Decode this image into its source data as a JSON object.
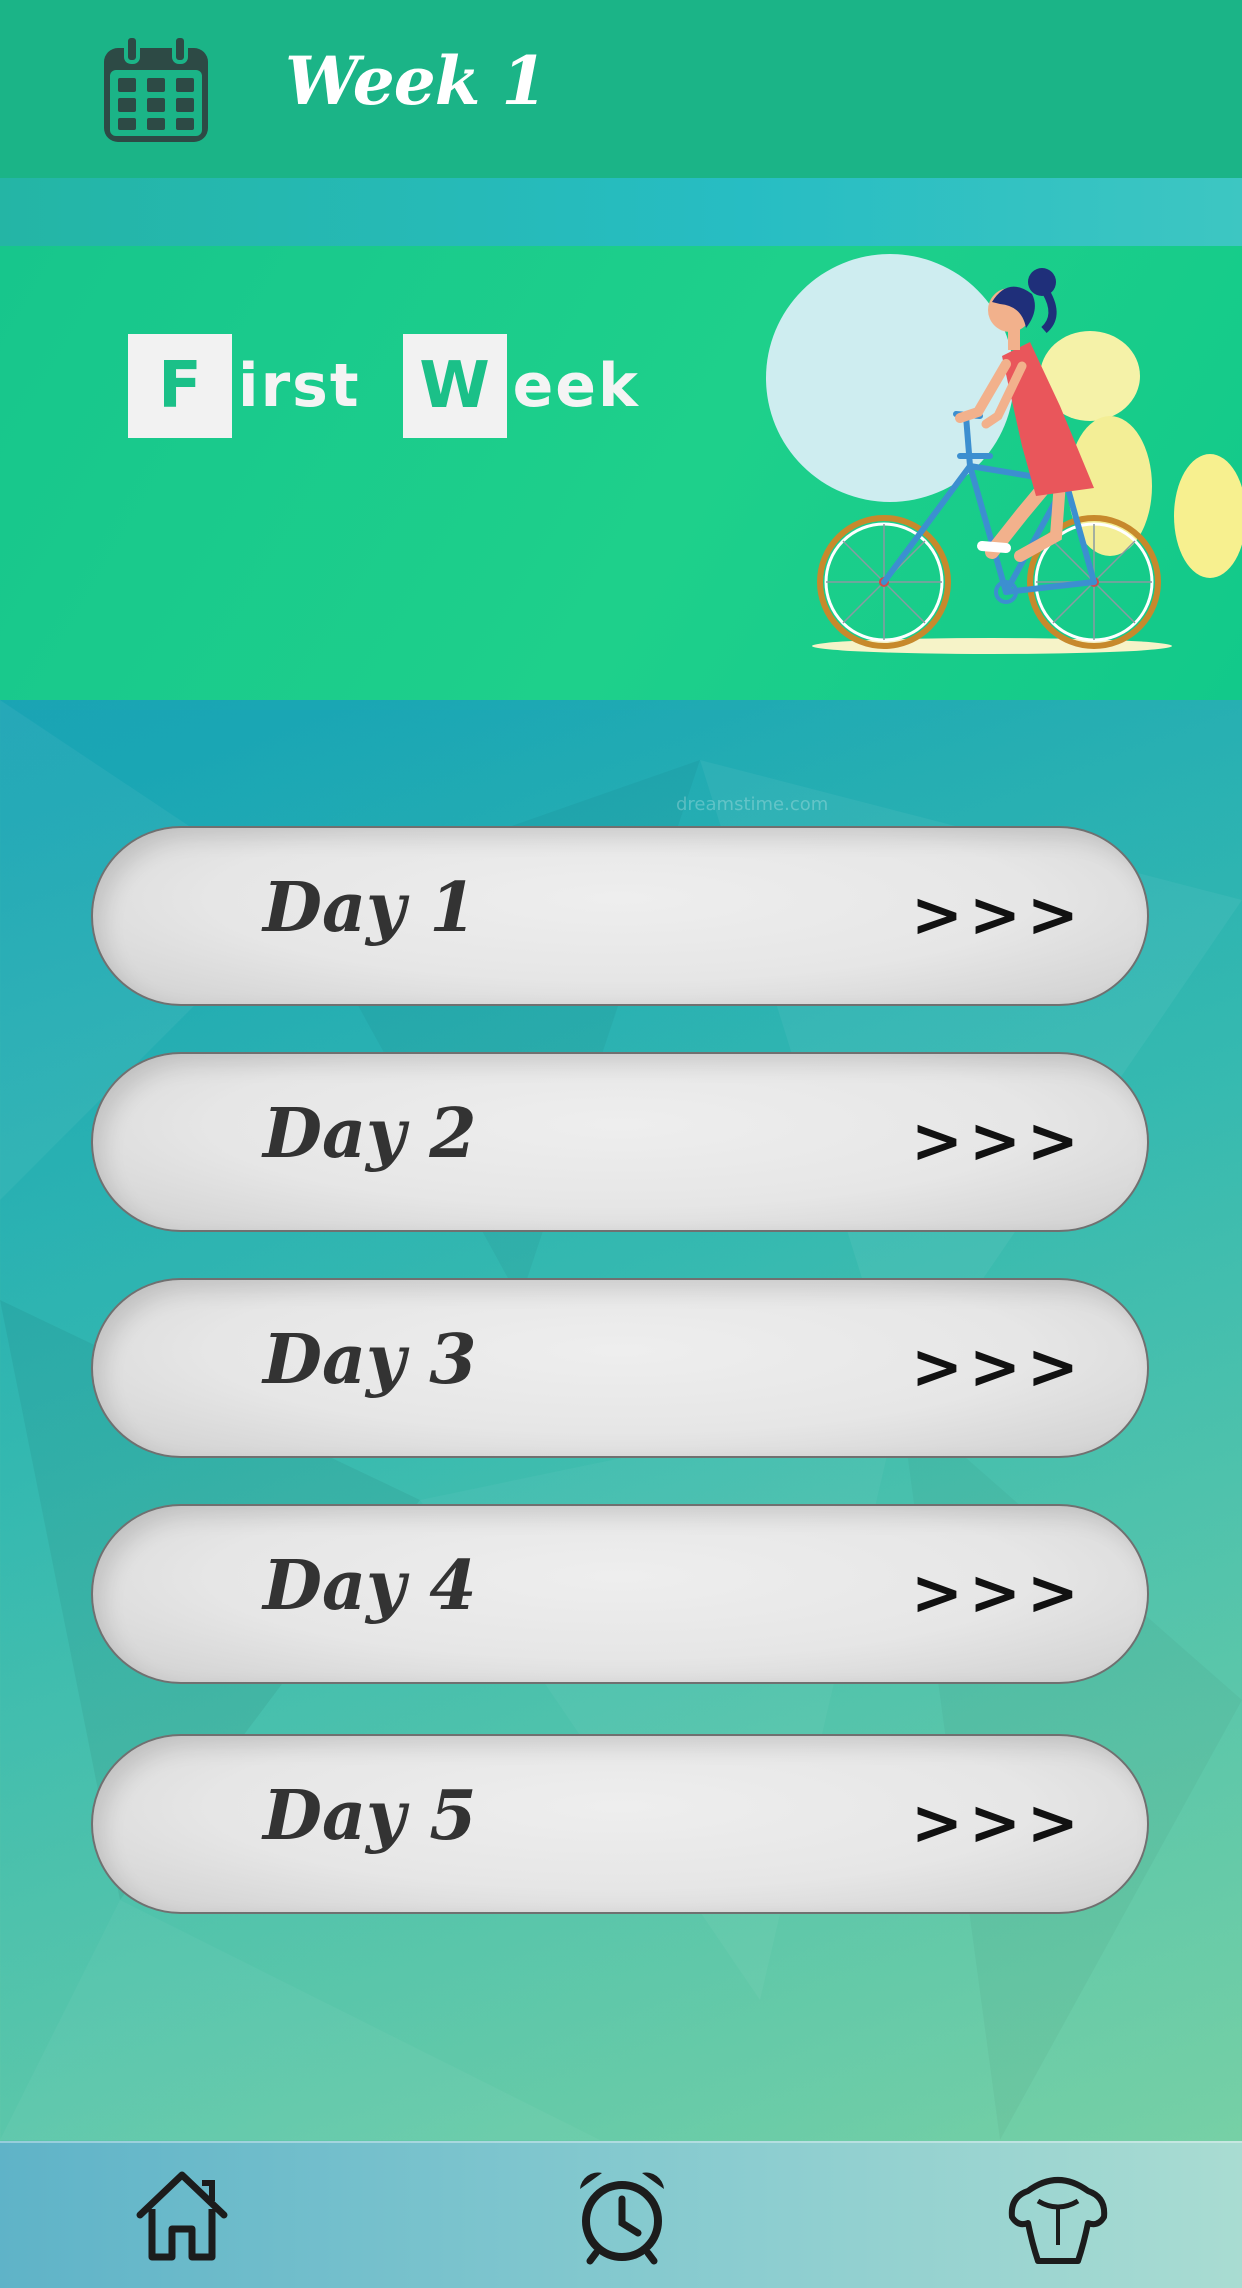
{
  "header": {
    "title": "Week 1",
    "calendar_icon": "calendar-icon"
  },
  "banner": {
    "title_first_initial": "F",
    "title_first_rest": "irst",
    "title_second_initial": "W",
    "title_second_rest": "eek",
    "illustration": "woman-riding-bicycle"
  },
  "watermark": "dreamstime.com",
  "days": [
    {
      "label": "Day 1",
      "arrow": ">>>"
    },
    {
      "label": "Day 2",
      "arrow": ">>>"
    },
    {
      "label": "Day 3",
      "arrow": ">>>"
    },
    {
      "label": "Day 4",
      "arrow": ">>>"
    },
    {
      "label": "Day 5",
      "arrow": ">>>"
    }
  ],
  "bottom_nav": [
    {
      "icon": "home-icon"
    },
    {
      "icon": "alarm-clock-icon"
    },
    {
      "icon": "muscle-torso-icon"
    }
  ],
  "colors": {
    "header_bg": "#1bb487",
    "banner_bg": "#1ed08b",
    "day_button_bg": "#e6e6e6",
    "text_dark": "#333333"
  }
}
